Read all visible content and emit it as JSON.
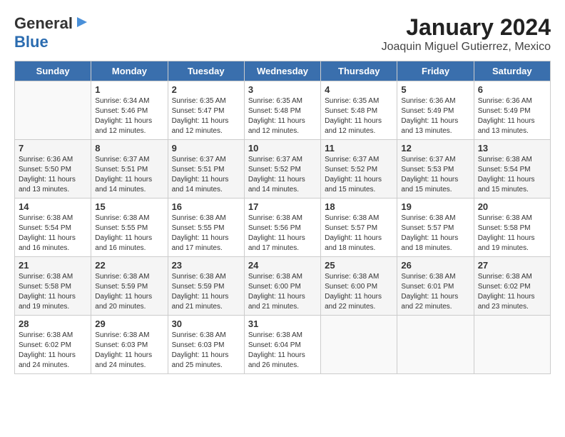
{
  "logo": {
    "line1": "General",
    "line2": "Blue"
  },
  "title": "January 2024",
  "subtitle": "Joaquin Miguel Gutierrez, Mexico",
  "headers": [
    "Sunday",
    "Monday",
    "Tuesday",
    "Wednesday",
    "Thursday",
    "Friday",
    "Saturday"
  ],
  "weeks": [
    [
      {
        "day": "",
        "info": ""
      },
      {
        "day": "1",
        "info": "Sunrise: 6:34 AM\nSunset: 5:46 PM\nDaylight: 11 hours\nand 12 minutes."
      },
      {
        "day": "2",
        "info": "Sunrise: 6:35 AM\nSunset: 5:47 PM\nDaylight: 11 hours\nand 12 minutes."
      },
      {
        "day": "3",
        "info": "Sunrise: 6:35 AM\nSunset: 5:48 PM\nDaylight: 11 hours\nand 12 minutes."
      },
      {
        "day": "4",
        "info": "Sunrise: 6:35 AM\nSunset: 5:48 PM\nDaylight: 11 hours\nand 12 minutes."
      },
      {
        "day": "5",
        "info": "Sunrise: 6:36 AM\nSunset: 5:49 PM\nDaylight: 11 hours\nand 13 minutes."
      },
      {
        "day": "6",
        "info": "Sunrise: 6:36 AM\nSunset: 5:49 PM\nDaylight: 11 hours\nand 13 minutes."
      }
    ],
    [
      {
        "day": "7",
        "info": "Sunrise: 6:36 AM\nSunset: 5:50 PM\nDaylight: 11 hours\nand 13 minutes."
      },
      {
        "day": "8",
        "info": "Sunrise: 6:37 AM\nSunset: 5:51 PM\nDaylight: 11 hours\nand 14 minutes."
      },
      {
        "day": "9",
        "info": "Sunrise: 6:37 AM\nSunset: 5:51 PM\nDaylight: 11 hours\nand 14 minutes."
      },
      {
        "day": "10",
        "info": "Sunrise: 6:37 AM\nSunset: 5:52 PM\nDaylight: 11 hours\nand 14 minutes."
      },
      {
        "day": "11",
        "info": "Sunrise: 6:37 AM\nSunset: 5:52 PM\nDaylight: 11 hours\nand 15 minutes."
      },
      {
        "day": "12",
        "info": "Sunrise: 6:37 AM\nSunset: 5:53 PM\nDaylight: 11 hours\nand 15 minutes."
      },
      {
        "day": "13",
        "info": "Sunrise: 6:38 AM\nSunset: 5:54 PM\nDaylight: 11 hours\nand 15 minutes."
      }
    ],
    [
      {
        "day": "14",
        "info": "Sunrise: 6:38 AM\nSunset: 5:54 PM\nDaylight: 11 hours\nand 16 minutes."
      },
      {
        "day": "15",
        "info": "Sunrise: 6:38 AM\nSunset: 5:55 PM\nDaylight: 11 hours\nand 16 minutes."
      },
      {
        "day": "16",
        "info": "Sunrise: 6:38 AM\nSunset: 5:55 PM\nDaylight: 11 hours\nand 17 minutes."
      },
      {
        "day": "17",
        "info": "Sunrise: 6:38 AM\nSunset: 5:56 PM\nDaylight: 11 hours\nand 17 minutes."
      },
      {
        "day": "18",
        "info": "Sunrise: 6:38 AM\nSunset: 5:57 PM\nDaylight: 11 hours\nand 18 minutes."
      },
      {
        "day": "19",
        "info": "Sunrise: 6:38 AM\nSunset: 5:57 PM\nDaylight: 11 hours\nand 18 minutes."
      },
      {
        "day": "20",
        "info": "Sunrise: 6:38 AM\nSunset: 5:58 PM\nDaylight: 11 hours\nand 19 minutes."
      }
    ],
    [
      {
        "day": "21",
        "info": "Sunrise: 6:38 AM\nSunset: 5:58 PM\nDaylight: 11 hours\nand 19 minutes."
      },
      {
        "day": "22",
        "info": "Sunrise: 6:38 AM\nSunset: 5:59 PM\nDaylight: 11 hours\nand 20 minutes."
      },
      {
        "day": "23",
        "info": "Sunrise: 6:38 AM\nSunset: 5:59 PM\nDaylight: 11 hours\nand 21 minutes."
      },
      {
        "day": "24",
        "info": "Sunrise: 6:38 AM\nSunset: 6:00 PM\nDaylight: 11 hours\nand 21 minutes."
      },
      {
        "day": "25",
        "info": "Sunrise: 6:38 AM\nSunset: 6:00 PM\nDaylight: 11 hours\nand 22 minutes."
      },
      {
        "day": "26",
        "info": "Sunrise: 6:38 AM\nSunset: 6:01 PM\nDaylight: 11 hours\nand 22 minutes."
      },
      {
        "day": "27",
        "info": "Sunrise: 6:38 AM\nSunset: 6:02 PM\nDaylight: 11 hours\nand 23 minutes."
      }
    ],
    [
      {
        "day": "28",
        "info": "Sunrise: 6:38 AM\nSunset: 6:02 PM\nDaylight: 11 hours\nand 24 minutes."
      },
      {
        "day": "29",
        "info": "Sunrise: 6:38 AM\nSunset: 6:03 PM\nDaylight: 11 hours\nand 24 minutes."
      },
      {
        "day": "30",
        "info": "Sunrise: 6:38 AM\nSunset: 6:03 PM\nDaylight: 11 hours\nand 25 minutes."
      },
      {
        "day": "31",
        "info": "Sunrise: 6:38 AM\nSunset: 6:04 PM\nDaylight: 11 hours\nand 26 minutes."
      },
      {
        "day": "",
        "info": ""
      },
      {
        "day": "",
        "info": ""
      },
      {
        "day": "",
        "info": ""
      }
    ]
  ]
}
